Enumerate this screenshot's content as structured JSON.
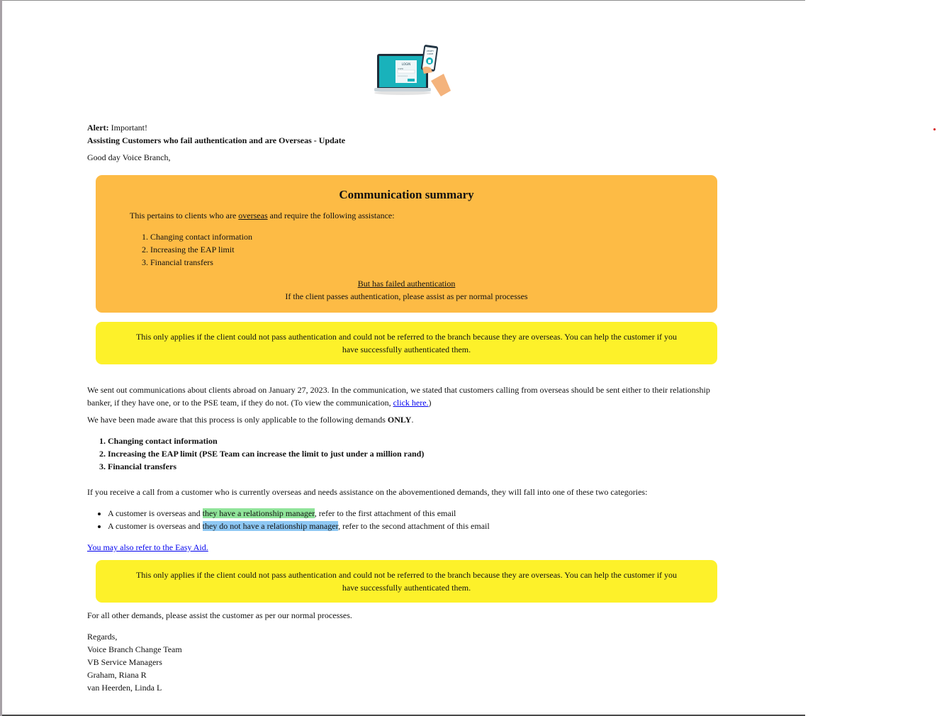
{
  "hero_image": {
    "icon": "laptop-login-verify-code-illustration",
    "login_label": "LOGIN",
    "user_label": "USER",
    "password_mask": "••••••••",
    "phone_label_1": "VERIFY",
    "phone_label_2": "CODE"
  },
  "header": {
    "alert_label": "Alert:",
    "alert_text": " Important!",
    "subject": "Assisting Customers who fail authentication and are Overseas - Update",
    "greeting": "Good day Voice Branch,"
  },
  "summary": {
    "title": "Communication summary",
    "intro_before": "This pertains to clients who are ",
    "intro_link": "overseas",
    "intro_after": " and require the following assistance:",
    "items": [
      "Changing contact information",
      "Increasing the EAP limit",
      "Financial transfers"
    ],
    "failed_note": "But has failed authentication",
    "pass_note": "If the client passes authentication, please assist as per normal processes"
  },
  "notice": {
    "text": "This only applies if the client could not pass authentication and could not be referred to the branch because they are overseas. You can help the customer if you have successfully authenticated them."
  },
  "body": {
    "para1_before": "We sent out communications about clients abroad on January 27, 2023. In the communication, we stated that customers calling from overseas should be sent either to their relationship banker, if they have one, or to the PSE team, if they do not. (To view the communication, ",
    "para1_link": "click here.",
    "para1_after": ")",
    "para2_before": "We have been made aware that this process is only applicable to the following demands ",
    "para2_bold": "ONLY",
    "para2_after": ".",
    "demands": [
      "Changing contact information",
      "Increasing the EAP limit (PSE Team can increase the limit to just under a million rand)",
      "Financial transfers"
    ],
    "para3": "If you receive a call from a customer who is currently overseas and needs assistance on the abovementioned demands, they will fall into one of these two categories:",
    "bullet1_before": "A customer is overseas and ",
    "bullet1_highlight": "they have a relationship manager",
    "bullet1_after": ", refer to the first attachment of this email",
    "bullet2_before": "A customer is overseas and ",
    "bullet2_highlight": "they do not have a relationship manager",
    "bullet2_after": ", refer to the second attachment of this email",
    "easy_aid_link": "You may also refer to the Easy Aid.",
    "para4": "For all other demands, please assist the customer as per our normal processes."
  },
  "signature": {
    "lines": [
      "Regards,",
      "Voice Branch Change Team",
      "VB Service Managers",
      "Graham, Riana R",
      "van Heerden, Linda L"
    ]
  },
  "colors": {
    "orange_box": "#fdbb45",
    "yellow_box": "#fdf12a",
    "highlight_green": "#90e49a",
    "highlight_blue": "#8ec8f4",
    "link": "#0000ee"
  }
}
